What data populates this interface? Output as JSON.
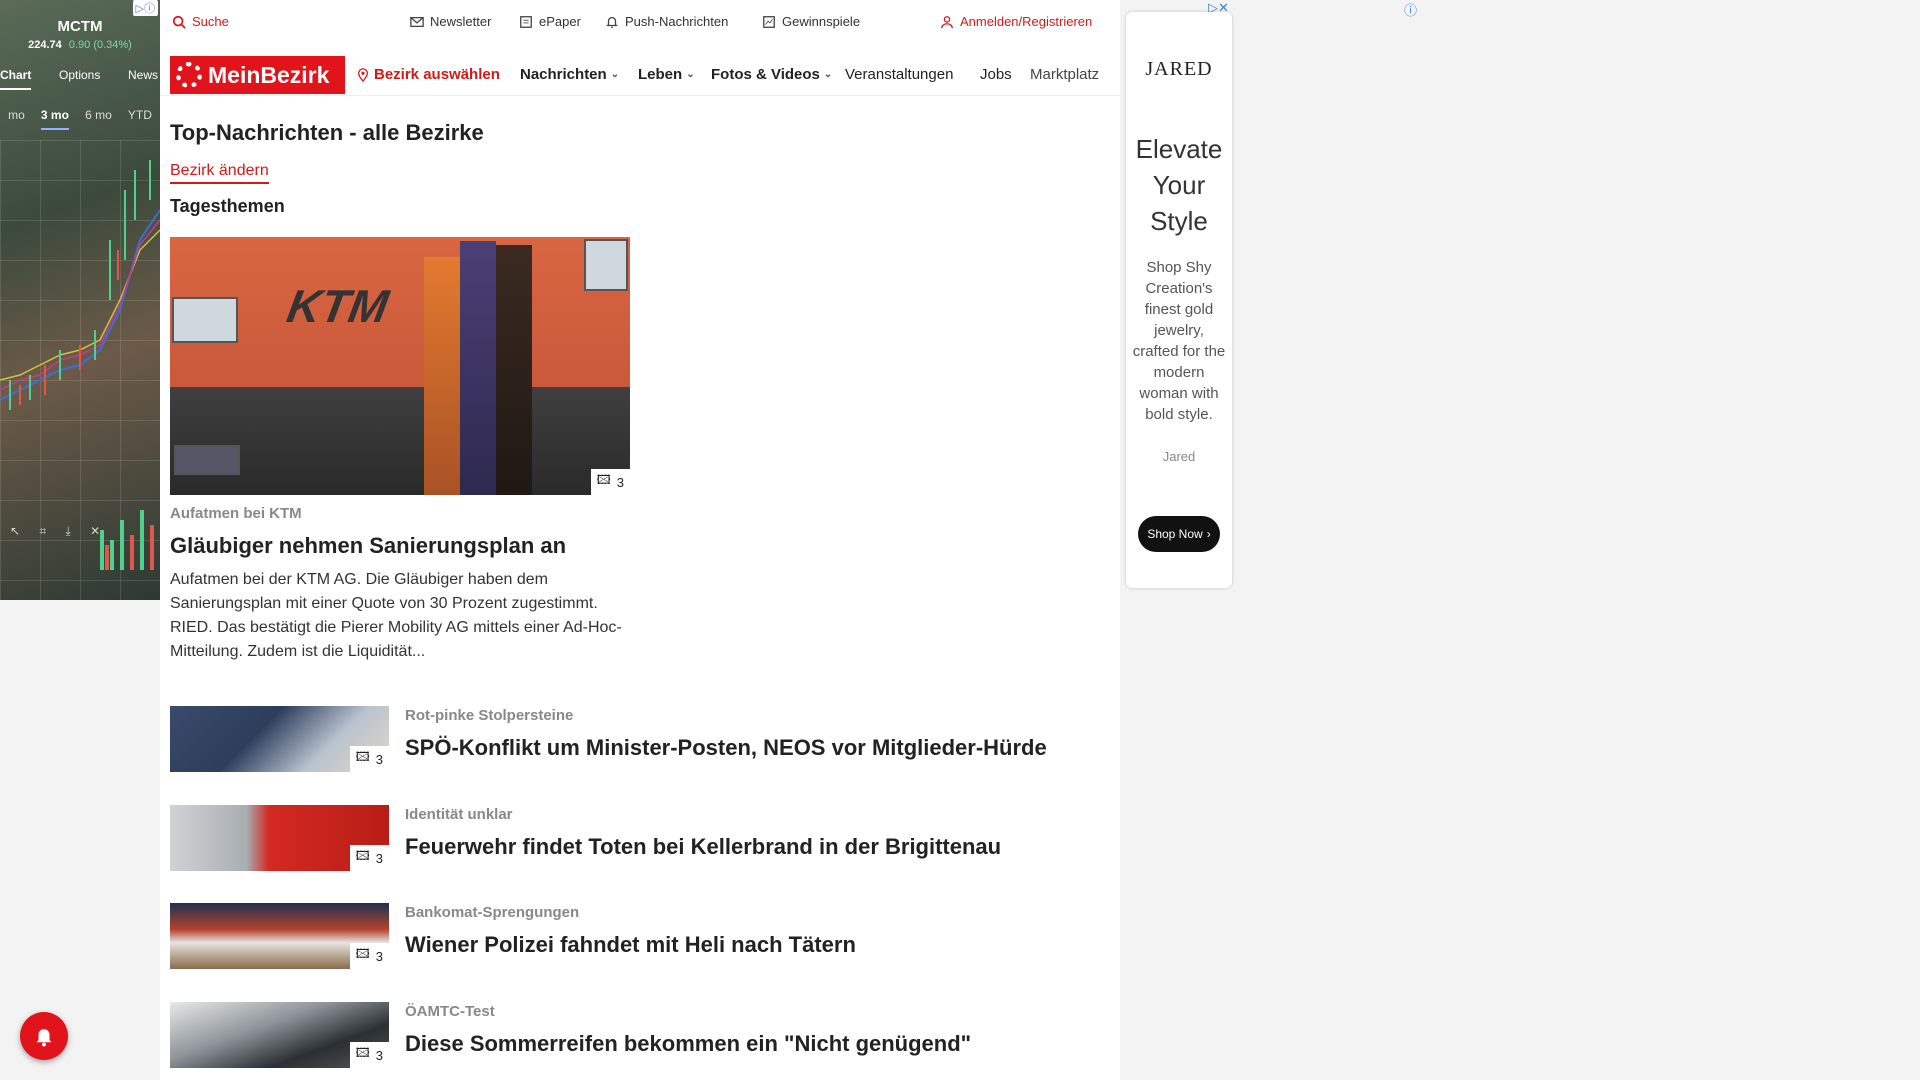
{
  "left_ad": {
    "symbol": "MCTM",
    "price": "224.74",
    "change": "0.90 (0.34%)",
    "tabs": [
      "Chart",
      "Options",
      "News"
    ],
    "active_tab": "Chart",
    "ranges": [
      "mo",
      "3 mo",
      "6 mo",
      "YTD"
    ],
    "active_range": "3 mo"
  },
  "topbar": {
    "search": "Suche",
    "newsletter": "Newsletter",
    "epaper": "ePaper",
    "push": "Push-Nachrichten",
    "gewinnspiele": "Gewinnspiele",
    "login": "Anmelden/Registrieren"
  },
  "nav": {
    "logo": "MeinBezirk",
    "bezirk": "Bezirk auswählen",
    "items": [
      "Nachrichten",
      "Leben",
      "Fotos & Videos",
      "Veranstaltungen",
      "Jobs",
      "Marktplatz"
    ]
  },
  "page": {
    "title": "Top-Nachrichten - alle Bezirke",
    "change_link": "Bezirk ändern",
    "section": "Tagesthemen"
  },
  "hero": {
    "image_text": "KTM",
    "image_count": "3",
    "kicker": "Aufatmen bei KTM",
    "headline": "Gläubiger nehmen Sanierungsplan an",
    "teaser": "Aufatmen bei der KTM AG. Die Gläubiger haben dem Sanierungsplan mit einer Quote von 30 Prozent zugestimmt. RIED. Das bestätigt die Pierer Mobility AG mittels einer Ad-Hoc-Mitteilung. Zudem ist die Liquidität..."
  },
  "articles": [
    {
      "kicker": "Rot-pinke Stolpersteine",
      "headline": "SPÖ-Konflikt um Minister-Posten, NEOS vor Mitglieder-Hürde",
      "count": "3"
    },
    {
      "kicker": "Identität unklar",
      "headline": "Feuerwehr findet Toten bei Kellerbrand in der Brigittenau",
      "count": "3"
    },
    {
      "kicker": "Bankomat-Sprengungen",
      "headline": "Wiener Polizei fahndet mit Heli nach Tätern",
      "count": "3"
    },
    {
      "kicker": "ÖAMTC-Test",
      "headline": "Diese Sommerreifen bekommen ein \"Nicht genügend\"",
      "count": "3"
    }
  ],
  "right_ad": {
    "brand": "JARED",
    "headline": "Elevate Your Style",
    "body": "Shop Shy Creation's finest gold jewelry, crafted for the modern woman with bold style.",
    "advertiser": "Jared",
    "cta": "Shop Now"
  },
  "colors": {
    "brand_red": "#e2141b",
    "text": "#222222"
  }
}
